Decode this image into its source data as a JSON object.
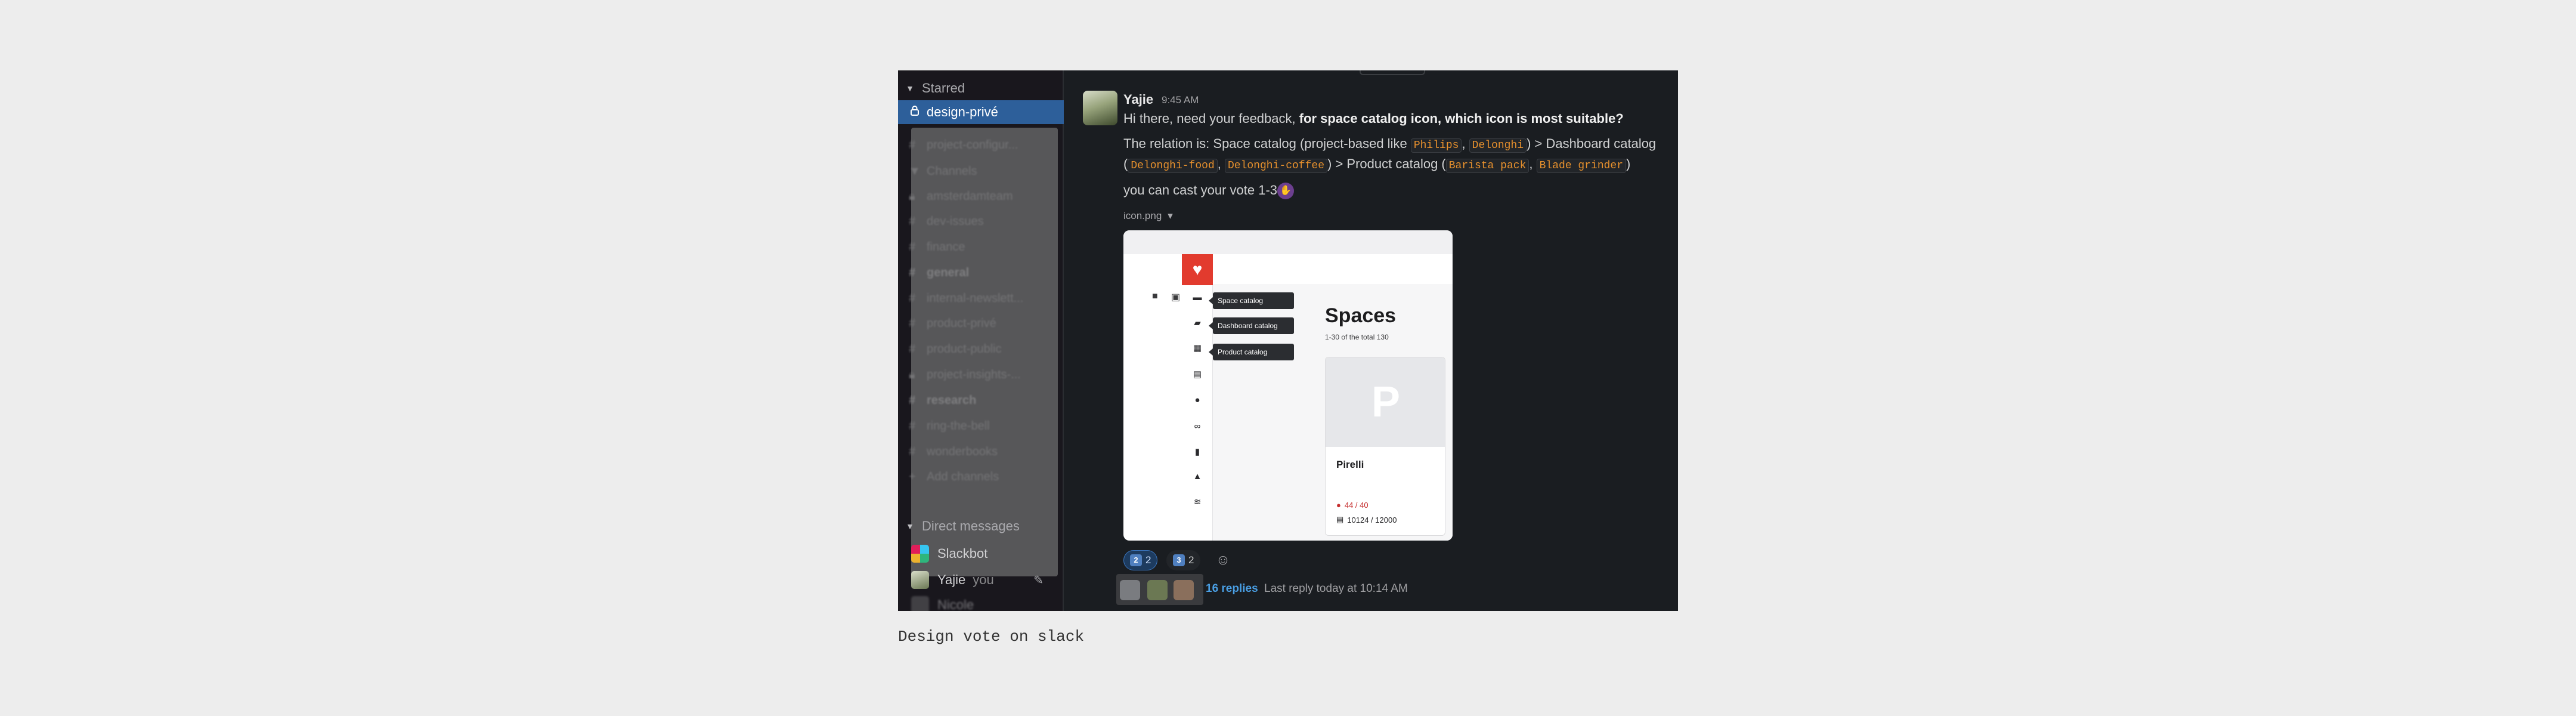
{
  "sidebar": {
    "starred_header": "Starred",
    "active_channel": "design-privé",
    "blurred_channel_1": "project-configur...",
    "channels_header": "Channels",
    "channels": [
      {
        "name": "amsterdamteam",
        "icon": "lock-icon",
        "bold": false
      },
      {
        "name": "dev-issues",
        "icon": "hash-icon",
        "bold": false
      },
      {
        "name": "finance",
        "icon": "hash-icon",
        "bold": false
      },
      {
        "name": "general",
        "icon": "hash-icon",
        "bold": true
      },
      {
        "name": "internal-newslett...",
        "icon": "hash-icon",
        "bold": false
      },
      {
        "name": "product-privé",
        "icon": "hash-icon",
        "bold": false
      },
      {
        "name": "product-public",
        "icon": "hash-icon",
        "bold": false
      },
      {
        "name": "project-insights-...",
        "icon": "lock-icon",
        "bold": false
      },
      {
        "name": "research",
        "icon": "hash-icon",
        "bold": true
      },
      {
        "name": "ring-the-bell",
        "icon": "hash-icon",
        "bold": false
      },
      {
        "name": "wonderbooks",
        "icon": "hash-icon",
        "bold": false
      }
    ],
    "add_channels": "Add channels",
    "dm_header": "Direct messages",
    "dms": {
      "slackbot": "Slackbot",
      "yajie": "Yajie",
      "yajie_you": "you",
      "blurred": "Nicole"
    }
  },
  "message": {
    "sender": "Yajie",
    "time": "9:45 AM",
    "line1_plain": "Hi there, need your feedback, ",
    "line1_bold": "for space catalog icon, which icon is most suitable?",
    "line2_a": "The relation is: Space catalog (project-based like ",
    "code_philips": "Philips",
    "sep_comma": ", ",
    "code_delonghi": "Delonghi",
    "line2_b": ") > Dashboard catalog",
    "line3_a": "(",
    "code_delonghi_food": "Delonghi-food",
    "code_delonghi_coffee": "Delonghi-coffee",
    "line3_b": ") > Product catalog (",
    "code_barista": "Barista pack",
    "code_blade": "Blade grinder",
    "line3_c": ")",
    "line4": "you can cast your vote 1-3",
    "file_name": "icon.png"
  },
  "preview": {
    "tooltips": [
      "Space catalog",
      "Dashboard catalog",
      "Product catalog"
    ],
    "title": "Spaces",
    "subtitle": "1-30 of the total 130",
    "card_letter": "P",
    "card_name": "Pirelli",
    "stat_red": "44 / 40",
    "stat_dark": "10124 / 12000",
    "brand_color": "#e23b2e"
  },
  "reactions": [
    {
      "key": "2",
      "count": "2",
      "mine": true
    },
    {
      "key": "3",
      "count": "2",
      "mine": false
    }
  ],
  "thread": {
    "replies": "16 replies",
    "last_reply": "Last reply today at 10:14 AM"
  },
  "caption": "Design vote on slack"
}
